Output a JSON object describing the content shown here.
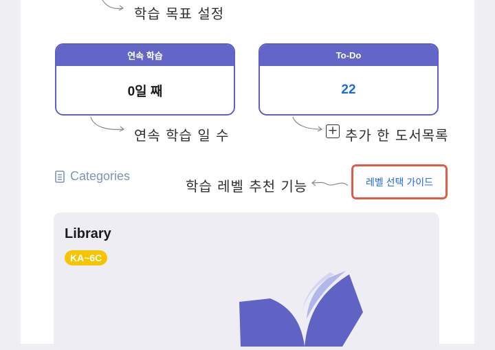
{
  "annotations": {
    "goal_setting": "학습 목표 설정",
    "streak_days": "연속 학습 일 수",
    "added_books": "추가 한 도서목록",
    "level_recommend": "학습 레벨 추천 기능"
  },
  "cards": {
    "streak": {
      "title": "연속 학습",
      "value": "0일 째"
    },
    "todo": {
      "title": "To-Do",
      "value": "22"
    }
  },
  "plus_symbol": "+",
  "categories": {
    "label": "Categories",
    "icon": "document-icon"
  },
  "guide_button": {
    "label": "레벨 선택 가이드"
  },
  "library": {
    "title": "Library",
    "badge": "KA~6C",
    "icon": "book-icon"
  },
  "colors": {
    "primary": "#6366c6",
    "todo_value": "#1e6ad8",
    "highlight_border": "#e05a45",
    "badge": "#f7c500"
  }
}
